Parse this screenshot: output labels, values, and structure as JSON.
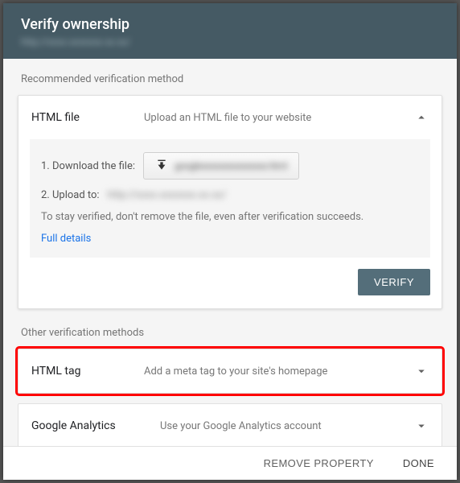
{
  "header": {
    "title": "Verify ownership",
    "subtitle": "http://xxxx.xxxxxxx.xx.xx/"
  },
  "recommended": {
    "section_label": "Recommended verification method",
    "method": {
      "title": "HTML file",
      "desc": "Upload an HTML file to your website",
      "step1_label": "1. Download the file:",
      "download_filename": "googlexxxxxxxxxxxxxxx.html",
      "step2_label": "2. Upload to:",
      "upload_target": "http://xxxx.xxxxxxx.xx.xx/",
      "note": "To stay verified, don't remove the file, even after verification succeeds.",
      "full_details": "Full details",
      "verify_label": "VERIFY"
    }
  },
  "other": {
    "section_label": "Other verification methods",
    "methods": [
      {
        "title": "HTML tag",
        "desc": "Add a meta tag to your site's homepage"
      },
      {
        "title": "Google Analytics",
        "desc": "Use your Google Analytics account"
      }
    ]
  },
  "footer": {
    "remove": "REMOVE PROPERTY",
    "done": "DONE"
  }
}
